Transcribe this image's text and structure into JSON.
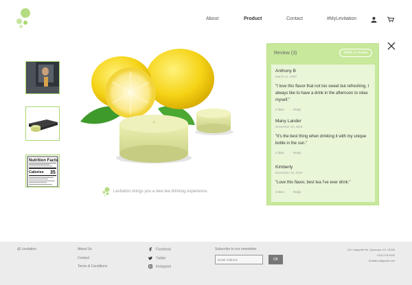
{
  "header": {
    "nav": [
      "About",
      "Product",
      "Contact",
      "#MyLevitation"
    ],
    "active": "Product",
    "icons": [
      "user-icon",
      "cart-icon"
    ]
  },
  "colors": {
    "accent": "#a8d86e",
    "panel": "#c8e89c",
    "panel_body": "#e9f6d8",
    "footer": "#ececec"
  },
  "product": {
    "caption": "Levitation brings you a new tea drinking experience.",
    "thumbnails": [
      "product-photo-thumbnail",
      "product-package-thumbnail",
      "nutrition-facts-thumbnail"
    ],
    "nutrition": {
      "title": "Nutrition Facts",
      "calories_label": "Calories",
      "calories_value": "35"
    }
  },
  "reviews": {
    "title": "Review (3)",
    "write_label": "Write a review",
    "items": [
      {
        "name": "Anthony B",
        "date": "March 11, 2020",
        "text": "\"I love this flavor that not too sweet but refreshing, I always like to have a drink in the afternoon to relax myself.\"",
        "likes": "2 likes",
        "reply": "Reply"
      },
      {
        "name": "Many Lander",
        "date": "November 22, 2019",
        "text": "\"It's the best thing when drinking it with my unique bottle in the sun.\"",
        "likes": "3 likes",
        "reply": "Reply"
      },
      {
        "name": "Kimberly",
        "date": "November 03, 2019",
        "text": "\"Love this flavor, best tea I've ever drink.\"",
        "likes": "3 likes",
        "reply": "Reply"
      }
    ]
  },
  "footer": {
    "brand": "@ Levitation",
    "links": [
      "About Us",
      "Contact",
      "Terms & Conditions"
    ],
    "social": [
      "Facebook",
      "Twitter",
      "Instagram"
    ],
    "newsletter_title": "Subscribe to our newsletter",
    "email_placeholder": "Email Address",
    "ok_label": "OK",
    "address": "241 Lafayette Rd, Syracuse, NY 13026",
    "phone": "+315 278 3190",
    "email": "levitation@gmail.com"
  }
}
